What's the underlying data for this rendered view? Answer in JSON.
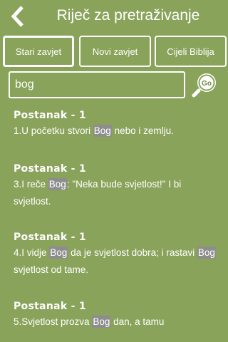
{
  "header": {
    "title": "Riječ za pretraživanje",
    "back_icon": "chevron-left-icon"
  },
  "tabs": [
    {
      "label": "Stari zavjet",
      "selected": true
    },
    {
      "label": "Novi zavjet",
      "selected": false
    },
    {
      "label": "Cijeli Biblija",
      "selected": false
    }
  ],
  "search": {
    "value": "bog",
    "go_label": "Go",
    "go_icon": "magnifier-go-icon"
  },
  "results": [
    {
      "title": "Postanak - 1",
      "parts": [
        {
          "text": "1.U početku stvori ",
          "hl": false
        },
        {
          "text": "Bog",
          "hl": true
        },
        {
          "text": " nebo i zemlju.",
          "hl": false
        }
      ]
    },
    {
      "title": "Postanak - 1",
      "parts": [
        {
          "text": "3.I reče ",
          "hl": false
        },
        {
          "text": "Bog",
          "hl": true
        },
        {
          "text": ": \"Neka bude svjetlost!\" I bi svjetlost.",
          "hl": false
        }
      ]
    },
    {
      "title": "Postanak - 1",
      "parts": [
        {
          "text": "4.I vidje ",
          "hl": false
        },
        {
          "text": "Bog",
          "hl": true
        },
        {
          "text": " da je svjetlost dobra; i rastavi ",
          "hl": false
        },
        {
          "text": "Bog",
          "hl": true
        },
        {
          "text": " svjetlost od tame.",
          "hl": false
        }
      ]
    },
    {
      "title": "Postanak - 1",
      "parts": [
        {
          "text": "5.Svjetlost prozva ",
          "hl": false
        },
        {
          "text": "Bog",
          "hl": true
        },
        {
          "text": " dan, a tamu",
          "hl": false
        }
      ]
    }
  ],
  "colors": {
    "background": "#8aa35b",
    "foreground": "#ffffff",
    "highlight": "#8d8d8d"
  }
}
